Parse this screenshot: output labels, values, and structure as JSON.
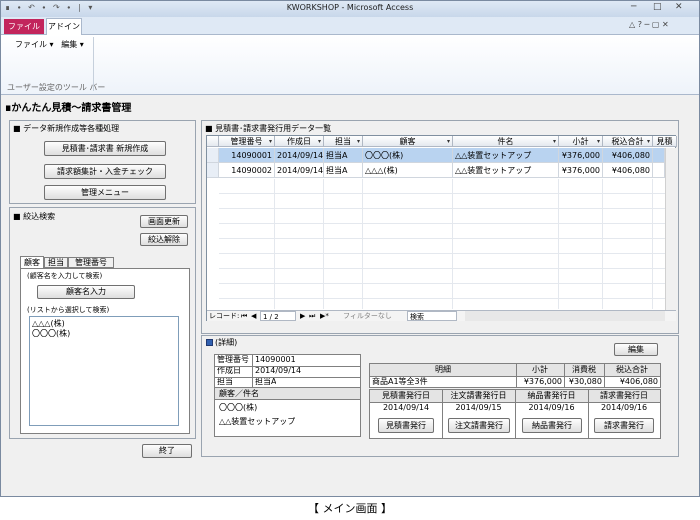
{
  "window": {
    "title": "KWORKSHOP - Microsoft Access",
    "qat": "∎ ∙ ↶ ∙ ↷ ∙ ∣ ▾",
    "min_icon": "─",
    "max_icon": "□",
    "close_icon": "✕"
  },
  "ribbon": {
    "tabs": [
      "ファイル",
      "アドイン"
    ],
    "menus": [
      "ファイル ▾",
      "編集 ▾"
    ],
    "group_label": "ユーザー設定のツール バー",
    "right_icons": "△ ? ─ ▢ ✕"
  },
  "form": {
    "title": "∎かんたん見積～請求書管理"
  },
  "data_section": {
    "title": "■ データ新規作成等各種処理",
    "buttons": [
      "見積書･請求書 新規作成",
      "請求額集計・入金チェック",
      "管理メニュー"
    ]
  },
  "search_section": {
    "title": "■ 絞込検索",
    "refresh_button": "画面更新",
    "clear_button": "絞込解除",
    "tabs": [
      "顧客",
      "担当",
      "管理番号"
    ],
    "hint1": "(顧客名を入力して検索)",
    "input_button": "顧客名入力",
    "hint2": "(リストから選択して検索)",
    "list": [
      "△△△(株)",
      "〇〇〇(株)"
    ]
  },
  "exit_button": "終了",
  "grid": {
    "title": "■ 見積書･請求書発行用データ一覧",
    "columns": [
      "管理番号",
      "作成日",
      "担当",
      "顧客",
      "件名",
      "小計",
      "税込合計",
      "見積"
    ],
    "rows": [
      [
        "14090001",
        "2014/09/14",
        "担当A",
        "〇〇〇(株)",
        "△△装置セットアップ",
        "¥376,000",
        "¥406,080",
        ""
      ],
      [
        "14090002",
        "2014/09/14",
        "担当A",
        "△△△(株)",
        "△△装置セットアップ",
        "¥376,000",
        "¥406,080",
        ""
      ]
    ],
    "nav": {
      "label": "レコード:",
      "first": "⏮",
      "prev": "◀",
      "position": "1 / 2",
      "next": "▶",
      "last": "⏭",
      "new": "▶*",
      "filter": "フィルターなし",
      "search": "検索"
    }
  },
  "detail": {
    "title": "(詳細)",
    "edit_button": "編集",
    "fields": [
      {
        "label": "管理番号",
        "value": "14090001"
      },
      {
        "label": "作成日",
        "value": "2014/09/14"
      },
      {
        "label": "担当",
        "value": "担当A"
      }
    ],
    "customer_header": "顧客／件名",
    "customer": "〇〇〇(株)",
    "subject": "△△装置セットアップ",
    "summary": {
      "headers": [
        "明細",
        "小計",
        "消費税",
        "税込合計"
      ],
      "values": [
        "商品A1等全3件",
        "¥376,000",
        "¥30,080",
        "¥406,080"
      ]
    },
    "issue": {
      "headers": [
        "見積書発行日",
        "注文請書発行日",
        "納品書発行日",
        "請求書発行日"
      ],
      "dates": [
        "2014/09/14",
        "2014/09/15",
        "2014/09/16",
        "2014/09/16"
      ],
      "buttons": [
        "見積書発行",
        "注文請書発行",
        "納品書発行",
        "請求書発行"
      ]
    }
  },
  "caption": "【 メイン画面 】"
}
